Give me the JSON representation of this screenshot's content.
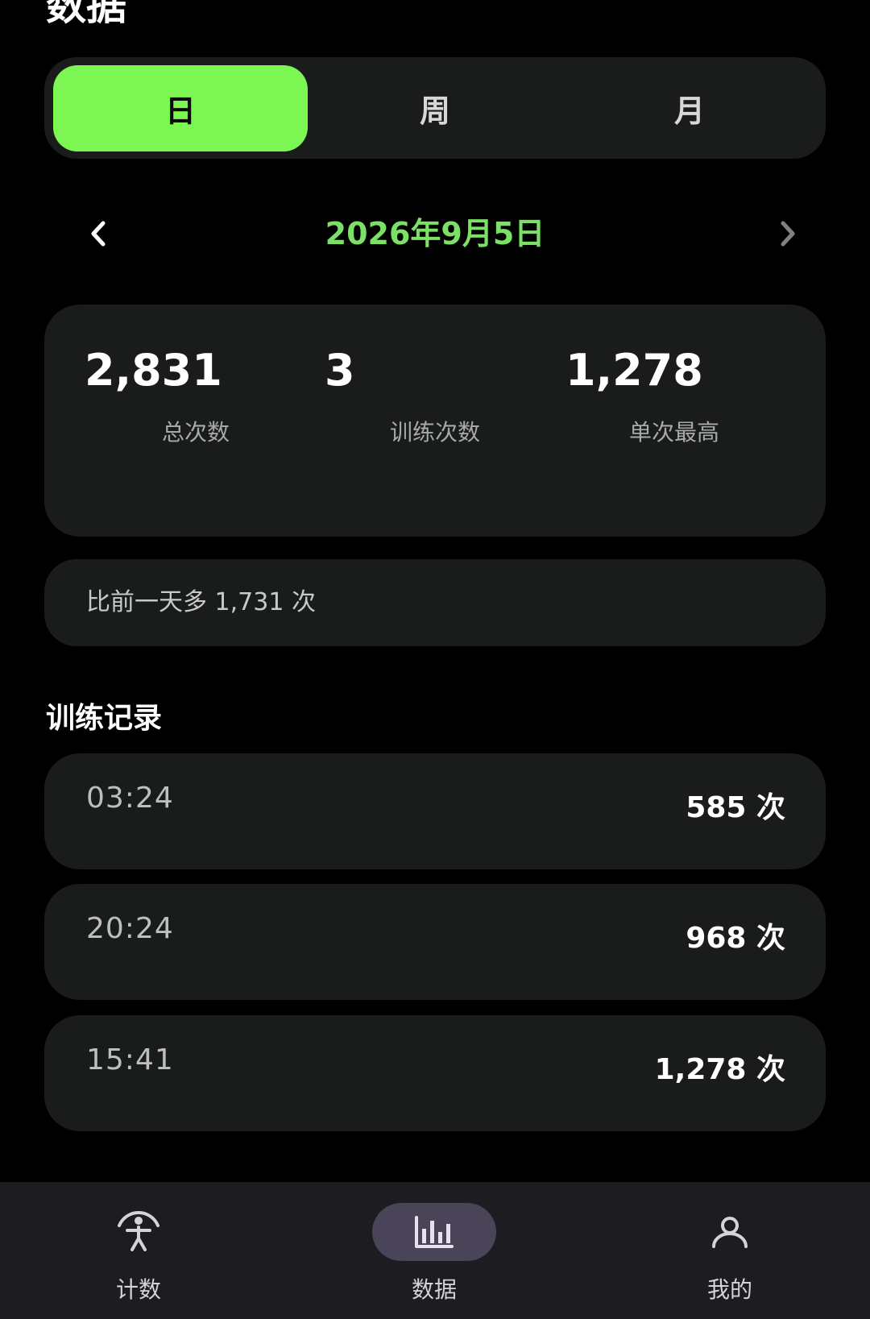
{
  "header": {
    "title": "数据"
  },
  "period_tabs": [
    {
      "label": "日",
      "selected": true
    },
    {
      "label": "周",
      "selected": false
    },
    {
      "label": "月",
      "selected": false
    }
  ],
  "date_nav": {
    "date": "2026年9月5日",
    "prev_icon": "chevron-left-icon",
    "next_icon": "chevron-right-icon"
  },
  "stats": [
    {
      "value": "2,831",
      "label": "总次数"
    },
    {
      "value": "3",
      "label": "训练次数"
    },
    {
      "value": "1,278",
      "label": "单次最高"
    }
  ],
  "comparison": {
    "text": "比前一天多 1,731 次"
  },
  "records_section": {
    "title": "训练记录",
    "items": [
      {
        "time": "03:24",
        "count": "585 次"
      },
      {
        "time": "20:24",
        "count": "968 次"
      },
      {
        "time": "15:41",
        "count": "1,278 次"
      }
    ]
  },
  "bottom_nav": [
    {
      "label": "计数",
      "icon": "exercise-person-icon",
      "active": false
    },
    {
      "label": "数据",
      "icon": "bar-chart-icon",
      "active": true
    },
    {
      "label": "我的",
      "icon": "user-profile-icon",
      "active": false
    }
  ],
  "colors": {
    "accent": "#7cf652",
    "date_text": "#7ce067",
    "background": "#000000",
    "card": "#1a1c1b",
    "nav_bar": "#1d1c21",
    "nav_active_pill": "#4a4458"
  }
}
